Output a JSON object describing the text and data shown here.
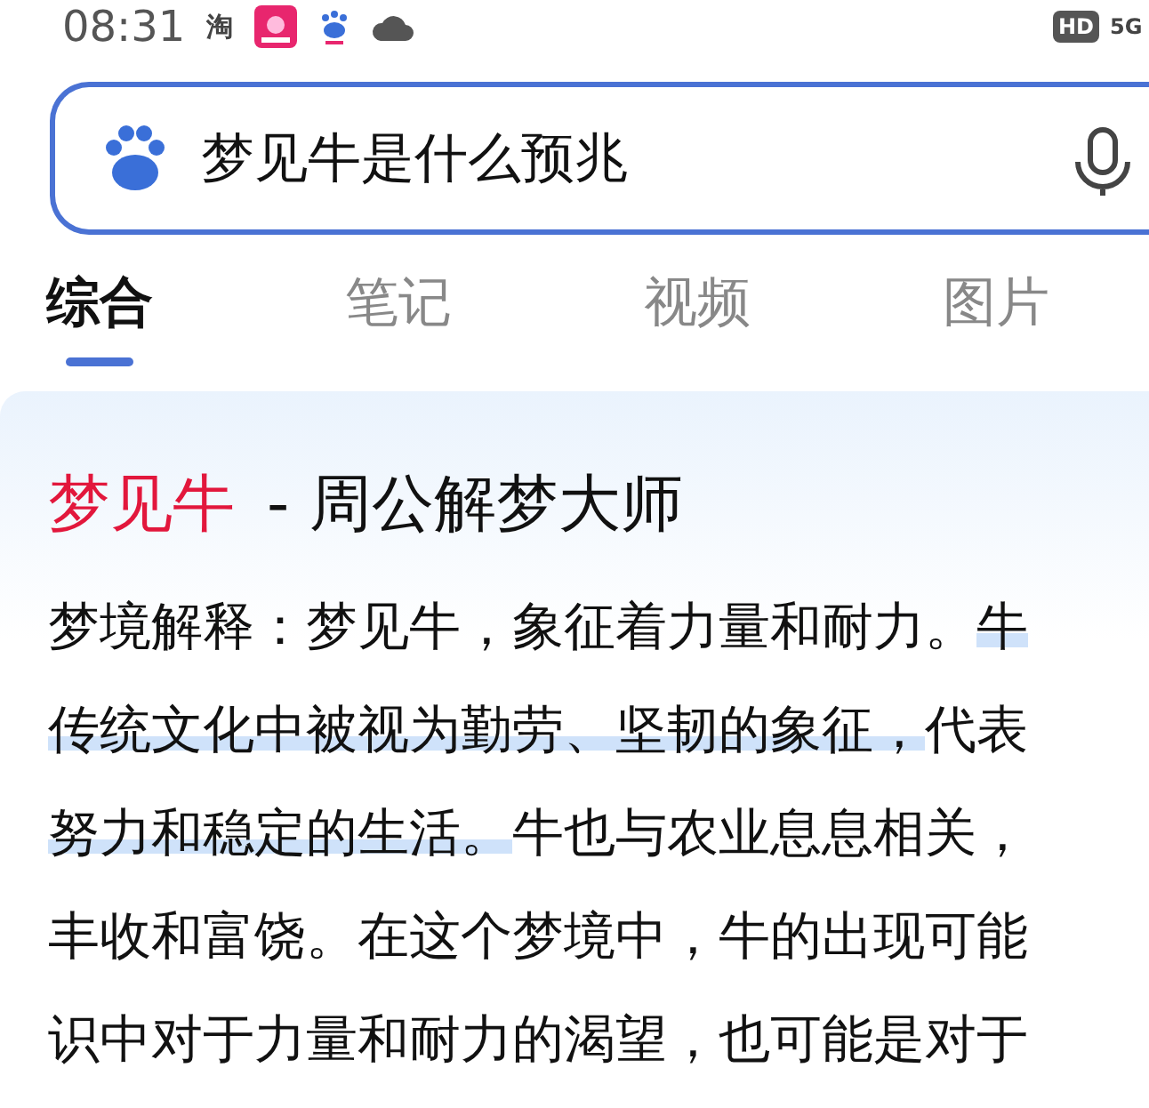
{
  "status_bar": {
    "time": "08:31",
    "app_label": "淘",
    "hd_badge": "HD",
    "network": "5G"
  },
  "search": {
    "value": "梦见牛是什么预兆"
  },
  "tabs": [
    {
      "label": "综合",
      "selected": true
    },
    {
      "label": "笔记",
      "selected": false
    },
    {
      "label": "视频",
      "selected": false
    },
    {
      "label": "图片",
      "selected": false
    }
  ],
  "result": {
    "title_keyword": "梦见牛",
    "title_rest": "- 周公解梦大师",
    "lines": [
      [
        {
          "text": "梦境解释：梦见牛，象征着力量和耐力。",
          "highlighted": false
        },
        {
          "text": "牛",
          "highlighted": true
        }
      ],
      [
        {
          "text": "传统文化中被视为勤劳、坚韧的象征，",
          "highlighted": true
        },
        {
          "text": "代表",
          "highlighted": false
        }
      ],
      [
        {
          "text": "努力和稳定的生活。",
          "highlighted": true
        },
        {
          "text": "牛也与农业息息相关，",
          "highlighted": false
        }
      ],
      [
        {
          "text": "丰收和富饶。在这个梦境中，牛的出现可能",
          "highlighted": false
        }
      ],
      [
        {
          "text": "识中对于力量和耐力的渴望，也可能是对于",
          "highlighted": false
        }
      ]
    ]
  }
}
